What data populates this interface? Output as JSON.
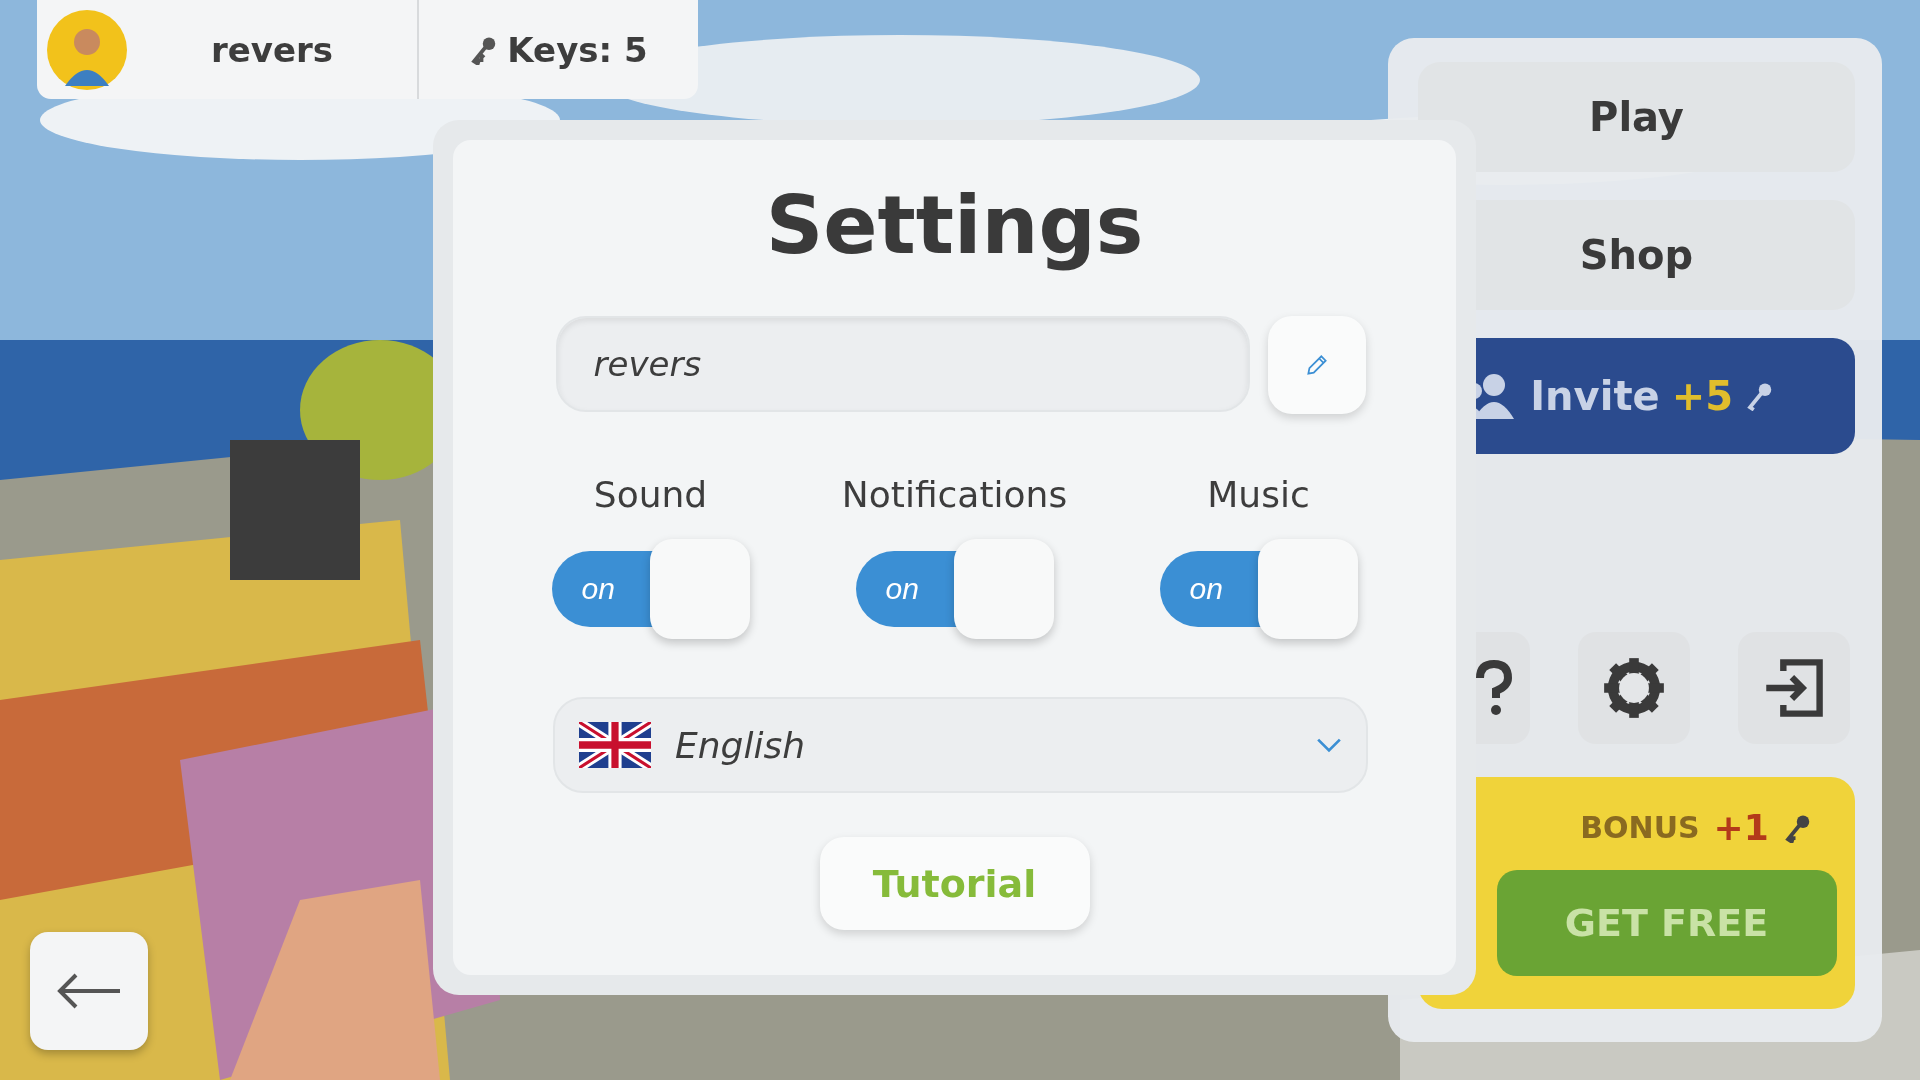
{
  "player": {
    "name": "revers",
    "keys": "Keys: 5"
  },
  "menu": {
    "buttons": [
      {
        "label": "Play"
      },
      {
        "label": "Shop"
      }
    ],
    "invite": {
      "label": "Invite",
      "reward": "+5"
    },
    "icons": [
      {
        "kind": "help"
      },
      {
        "kind": "settings"
      },
      {
        "kind": "exit"
      }
    ],
    "bonus": {
      "label": "BONUS",
      "reward": "+1",
      "button": "GET FREE"
    }
  },
  "settings": {
    "title": "Settings",
    "name_field": {
      "value": "revers"
    },
    "toggles": [
      {
        "label": "Sound",
        "state_text": "on",
        "on": true
      },
      {
        "label": "Notifications",
        "state_text": "on",
        "on": true
      },
      {
        "label": "Music",
        "state_text": "on",
        "on": true
      }
    ],
    "language": {
      "value": "English"
    },
    "tutorial": "Tutorial"
  }
}
